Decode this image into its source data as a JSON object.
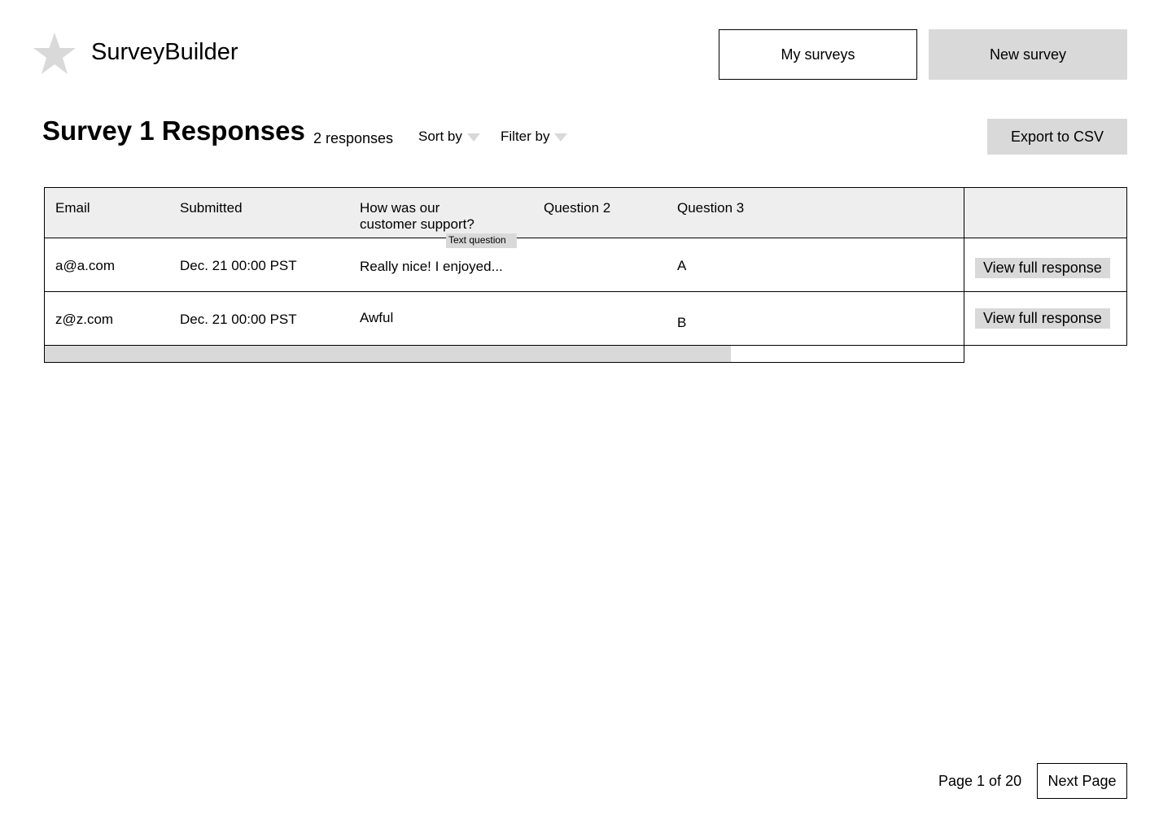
{
  "app": {
    "name": "SurveyBuilder",
    "logo_icon": "star-icon"
  },
  "nav": {
    "my_surveys": "My surveys",
    "new_survey": "New survey"
  },
  "page": {
    "title": "Survey 1 Responses",
    "count": "2 responses",
    "sort_by": "Sort by",
    "filter_by": "Filter by",
    "export": "Export to CSV"
  },
  "table": {
    "columns": [
      "Email",
      "Submitted",
      "How was our customer support?",
      "Question 2",
      "Question 3"
    ],
    "column_tag": "Text question",
    "rows": [
      {
        "email": "a@a.com",
        "submitted": "Dec. 21 00:00 PST",
        "q1": "Really nice! I enjoyed...",
        "q2": "",
        "q3": "A",
        "action": "View full response"
      },
      {
        "email": "z@z.com",
        "submitted": "Dec. 21 00:00 PST",
        "q1": "Awful",
        "q2": "",
        "q3": "B",
        "action": "View full response"
      }
    ],
    "scroll_fraction": 0.75
  },
  "pagination": {
    "label": "Page 1 of 20",
    "next": "Next Page"
  },
  "colors": {
    "gray": "#d9d9d9",
    "header_bg": "#eeeeee"
  }
}
